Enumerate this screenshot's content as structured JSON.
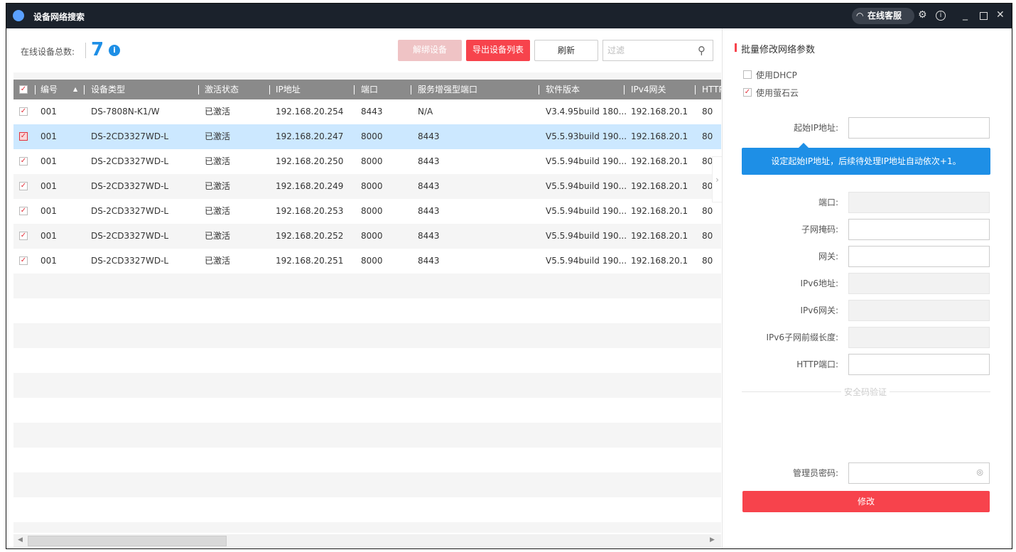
{
  "window": {
    "title": "设备网络搜索",
    "support_label": "在线客服",
    "icons": [
      "app-logo-icon",
      "headset-icon",
      "gear-icon",
      "info-icon",
      "minimize-icon",
      "maximize-icon",
      "close-icon"
    ]
  },
  "summary": {
    "label": "在线设备总数:",
    "count": "7"
  },
  "toolbar": {
    "unbind": "解绑设备",
    "export": "导出设备列表",
    "refresh": "刷新",
    "filter_placeholder": "过滤"
  },
  "table": {
    "columns": [
      "编号",
      "设备类型",
      "激活状态",
      "IP地址",
      "端口",
      "服务增强型端口",
      "软件版本",
      "IPv4网关",
      "HTTP"
    ],
    "rows": [
      [
        "001",
        "DS-7808N-K1/W",
        "已激活",
        "192.168.20.254",
        "8443",
        "N/A",
        "V3.4.95build 180...",
        "192.168.20.1",
        "80"
      ],
      [
        "001",
        "DS-2CD3327WD-L",
        "已激活",
        "192.168.20.247",
        "8000",
        "8443",
        "V5.5.93build 190...",
        "192.168.20.1",
        "80"
      ],
      [
        "001",
        "DS-2CD3327WD-L",
        "已激活",
        "192.168.20.250",
        "8000",
        "8443",
        "V5.5.94build 190...",
        "192.168.20.1",
        "80"
      ],
      [
        "001",
        "DS-2CD3327WD-L",
        "已激活",
        "192.168.20.249",
        "8000",
        "8443",
        "V5.5.94build 190...",
        "192.168.20.1",
        "80"
      ],
      [
        "001",
        "DS-2CD3327WD-L",
        "已激活",
        "192.168.20.253",
        "8000",
        "8443",
        "V5.5.94build 190...",
        "192.168.20.1",
        "80"
      ],
      [
        "001",
        "DS-2CD3327WD-L",
        "已激活",
        "192.168.20.252",
        "8000",
        "8443",
        "V5.5.94build 190...",
        "192.168.20.1",
        "80"
      ],
      [
        "001",
        "DS-2CD3327WD-L",
        "已激活",
        "192.168.20.251",
        "8000",
        "8443",
        "V5.5.94build 190...",
        "192.168.20.1",
        "80"
      ]
    ],
    "selected_row": 1
  },
  "panel": {
    "title": "批量修改网络参数",
    "use_dhcp": {
      "label": "使用DHCP",
      "checked": false
    },
    "use_ezviz": {
      "label": "使用萤石云",
      "checked": true
    },
    "start_ip_label": "起始IP地址:",
    "tooltip": "设定起始IP地址，后续待处理IP地址自动依次+1。",
    "fields": [
      {
        "label": "端口:",
        "disabled": true
      },
      {
        "label": "子网掩码:",
        "disabled": false
      },
      {
        "label": "网关:",
        "disabled": false
      },
      {
        "label": "IPv6地址:",
        "disabled": true
      },
      {
        "label": "IPv6网关:",
        "disabled": true
      },
      {
        "label": "IPv6子网前缀长度:",
        "disabled": true
      },
      {
        "label": "HTTP端口:",
        "disabled": false
      }
    ],
    "security_title": "安全码验证",
    "password_label": "管理员密码:",
    "submit": "修改"
  },
  "colors": {
    "accent_red": "#f7434c",
    "blue": "#1e8fe6",
    "selected_row": "#cce8ff",
    "titlebar": "#1b222c"
  }
}
